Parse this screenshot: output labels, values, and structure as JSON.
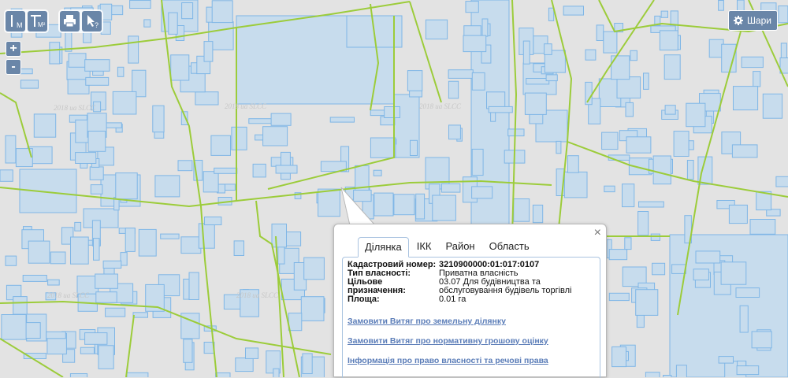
{
  "toolbar": {
    "measure_length_label": "М",
    "measure_area_label": "М²",
    "print_icon": "printer-icon",
    "identify_icon": "pointer-question-icon"
  },
  "zoom": {
    "in": "+",
    "out": "-"
  },
  "layers_button": {
    "label": "Шари",
    "icon": "gear-icon"
  },
  "watermarks": [
    "2018 ua SLCC",
    "2018 ua SLCC",
    "2018 ua SLCC",
    "2018 ua SLCC",
    "2018 ua SLCC"
  ],
  "popup": {
    "tabs": [
      "Ділянка",
      "ІКК",
      "Район",
      "Область"
    ],
    "active_tab": "Ділянка",
    "fields": [
      {
        "key": "Кадастровий номер:",
        "value": "3210900000:01:017:0107"
      },
      {
        "key": "Тип власності:",
        "value": "Приватна власність"
      },
      {
        "key": "Цільове призначення:",
        "value": "03.07 Для будівництва та обслуговування будівель торгівлі"
      },
      {
        "key": "Площа:",
        "value": "0.01 га"
      }
    ],
    "links": [
      "Замовити Витяг про земельну ділянку",
      "Замовити Витяг про нормативну грошову оцінку",
      "Інформація про право власності та речові права"
    ],
    "close": "×"
  },
  "colors": {
    "background": "#e3e3e3",
    "parcel_fill": "#c7dced",
    "parcel_stroke": "#7fb6e6",
    "block_line": "#9ccc3a",
    "control": "#6a86a8"
  }
}
